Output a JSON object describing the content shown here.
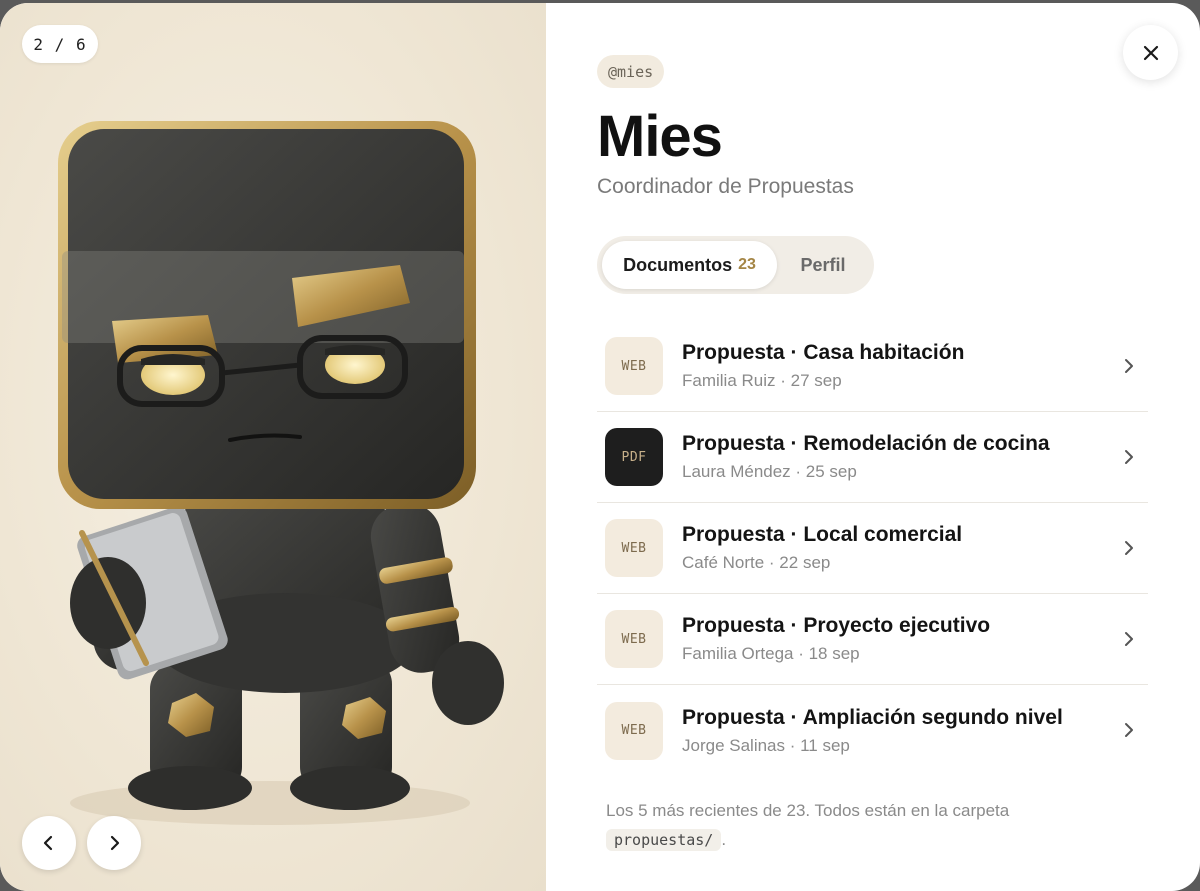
{
  "viewer": {
    "counter": "2 / 6"
  },
  "profile": {
    "handle": "@mies",
    "name": "Mies",
    "role": "Coordinador de Propuestas"
  },
  "tabs": {
    "documents_label": "Documentos",
    "documents_count": "23",
    "profile_label": "Perfil"
  },
  "documents": [
    {
      "type": "WEB",
      "title": "Propuesta · Casa habitación",
      "meta": "Familia Ruiz · 27 sep"
    },
    {
      "type": "PDF",
      "title": "Propuesta · Remodelación de cocina",
      "meta": "Laura Méndez · 25 sep"
    },
    {
      "type": "WEB",
      "title": "Propuesta · Local comercial",
      "meta": "Café Norte · 22 sep"
    },
    {
      "type": "WEB",
      "title": "Propuesta · Proyecto ejecutivo",
      "meta": "Familia Ortega · 18 sep"
    },
    {
      "type": "WEB",
      "title": "Propuesta · Ampliación segundo nivel",
      "meta": "Jorge Salinas · 11 sep"
    }
  ],
  "footnote": {
    "text": "Los 5 más recientes de 23. Todos están en la carpeta",
    "folder": "propuestas/",
    "end": "."
  },
  "icons": {
    "close": "close-icon",
    "prev": "chevron-left-icon",
    "next": "chevron-right-icon",
    "row": "chevron-right-icon"
  }
}
